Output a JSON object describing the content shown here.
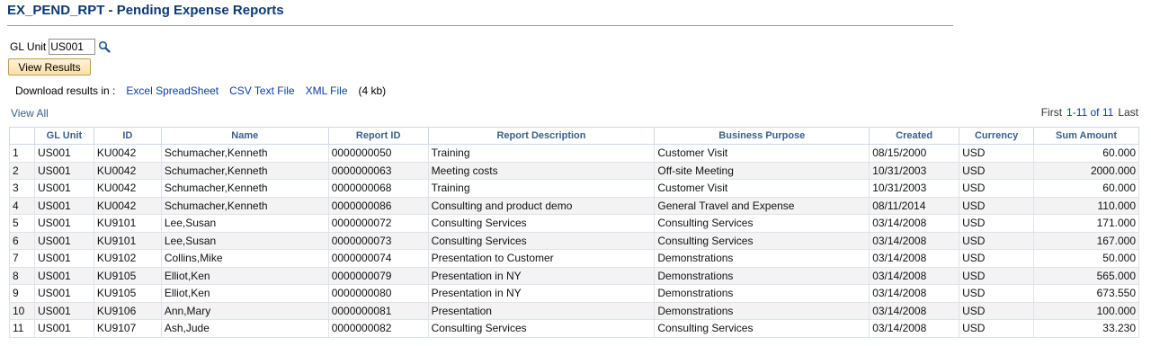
{
  "page": {
    "title": "EX_PEND_RPT - Pending Expense Reports"
  },
  "criteria": {
    "gl_unit_label": "GL Unit",
    "gl_unit_value": "US001",
    "view_results_label": "View Results"
  },
  "download": {
    "label": "Download results in :",
    "excel": "Excel SpreadSheet",
    "csv": "CSV Text File",
    "xml": "XML File",
    "size": "(4 kb)"
  },
  "grid": {
    "view_all": "View All",
    "pager": {
      "first": "First",
      "range": "1-11 of 11",
      "last": "Last"
    },
    "columns": [
      "",
      "GL Unit",
      "ID",
      "Name",
      "Report ID",
      "Report Description",
      "Business Purpose",
      "Created",
      "Currency",
      "Sum Amount"
    ],
    "rows": [
      [
        "1",
        "US001",
        "KU0042",
        "Schumacher,Kenneth",
        "0000000050",
        "Training",
        "Customer Visit",
        "08/15/2000",
        "USD",
        "60.000"
      ],
      [
        "2",
        "US001",
        "KU0042",
        "Schumacher,Kenneth",
        "0000000063",
        "Meeting costs",
        "Off-site Meeting",
        "10/31/2003",
        "USD",
        "2000.000"
      ],
      [
        "3",
        "US001",
        "KU0042",
        "Schumacher,Kenneth",
        "0000000068",
        "Training",
        "Customer Visit",
        "10/31/2003",
        "USD",
        "60.000"
      ],
      [
        "4",
        "US001",
        "KU0042",
        "Schumacher,Kenneth",
        "0000000086",
        "Consulting and product demo",
        "General Travel and Expense",
        "08/11/2014",
        "USD",
        "110.000"
      ],
      [
        "5",
        "US001",
        "KU9101",
        "Lee,Susan",
        "0000000072",
        "Consulting Services",
        "Consulting Services",
        "03/14/2008",
        "USD",
        "171.000"
      ],
      [
        "6",
        "US001",
        "KU9101",
        "Lee,Susan",
        "0000000073",
        "Consulting Services",
        "Consulting Services",
        "03/14/2008",
        "USD",
        "167.000"
      ],
      [
        "7",
        "US001",
        "KU9102",
        "Collins,Mike",
        "0000000074",
        "Presentation to Customer",
        "Demonstrations",
        "03/14/2008",
        "USD",
        "50.000"
      ],
      [
        "8",
        "US001",
        "KU9105",
        "Elliot,Ken",
        "0000000079",
        "Presentation in NY",
        "Demonstrations",
        "03/14/2008",
        "USD",
        "565.000"
      ],
      [
        "9",
        "US001",
        "KU9105",
        "Elliot,Ken",
        "0000000080",
        "Presentation in NY",
        "Demonstrations",
        "03/14/2008",
        "USD",
        "673.550"
      ],
      [
        "10",
        "US001",
        "KU9106",
        "Ann,Mary",
        "0000000081",
        "Presentation",
        "Demonstrations",
        "03/14/2008",
        "USD",
        "100.000"
      ],
      [
        "11",
        "US001",
        "KU9107",
        "Ash,Jude",
        "0000000082",
        "Consulting Services",
        "Consulting Services",
        "03/14/2008",
        "USD",
        "33.230"
      ]
    ]
  }
}
